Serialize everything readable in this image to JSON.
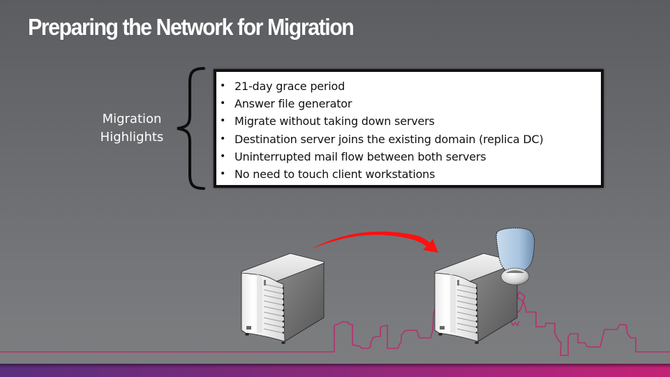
{
  "slide": {
    "title": "Preparing the Network for Migration",
    "highlights_label_line1": "Migration",
    "highlights_label_line2": "Highlights",
    "bullet_glyph": "•",
    "bullets": [
      "21-day grace period",
      "Answer file generator",
      "Migrate without taking down servers",
      "Destination server joins the existing domain (replica DC)",
      "Uninterrupted mail flow between both servers",
      "No need to touch client workstations"
    ]
  },
  "illustration": {
    "source_server_icon": "server-icon",
    "destination_server_icon": "server-with-domain-controller-icon",
    "arrow_icon": "curved-arrow-icon",
    "skyline_icon": "city-skyline-outline"
  },
  "colors": {
    "arrow": "#ff1010",
    "skyline": "#b4306e",
    "band_start": "#5a2f7e",
    "band_end": "#c42277",
    "title_text": "#ffffff",
    "box_border": "#111111"
  }
}
